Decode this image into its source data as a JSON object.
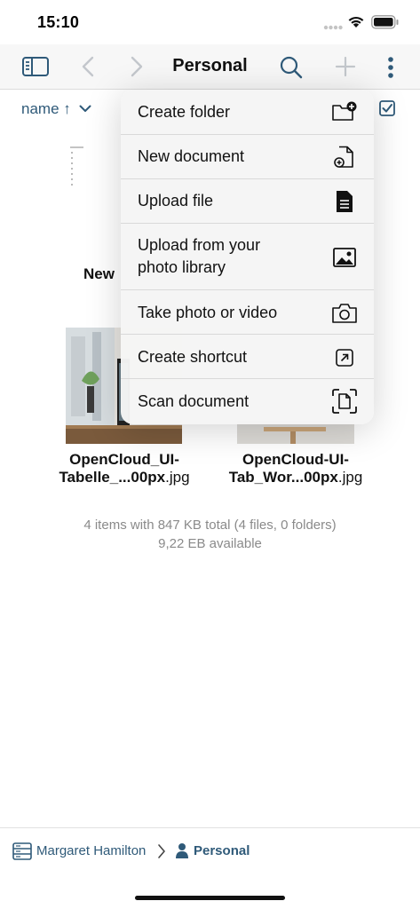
{
  "status_bar": {
    "time": "15:10"
  },
  "toolbar": {
    "title": "Personal"
  },
  "sort": {
    "label": "name ↑"
  },
  "content": {
    "partial_label": "New",
    "files": [
      {
        "name_bold": "OpenCloud_UI-",
        "name_line2_bold": "Tabelle_...00px",
        "ext": ".jpg"
      },
      {
        "name_bold": "OpenCloud-UI-",
        "name_line2_bold": "Tab_Wor...00px",
        "ext": ".jpg"
      }
    ],
    "summary_line1": "4 items with 847 KB total (4 files, 0 folders)",
    "summary_line2": "9,22 EB available"
  },
  "menu": {
    "items": [
      {
        "label": "Create folder",
        "icon": "folder-plus-icon"
      },
      {
        "label": "New document",
        "icon": "new-document-icon"
      },
      {
        "label": "Upload file",
        "icon": "file-icon"
      },
      {
        "label_line1": "Upload from your",
        "label_line2": "photo library",
        "icon": "photo-icon"
      },
      {
        "label": "Take photo or video",
        "icon": "camera-icon"
      },
      {
        "label": "Create shortcut",
        "icon": "shortcut-icon"
      },
      {
        "label": "Scan document",
        "icon": "scan-document-icon"
      }
    ]
  },
  "breadcrumb": {
    "parent": "Margaret Hamilton",
    "current": "Personal"
  },
  "colors": {
    "accent": "#2f5a79"
  }
}
